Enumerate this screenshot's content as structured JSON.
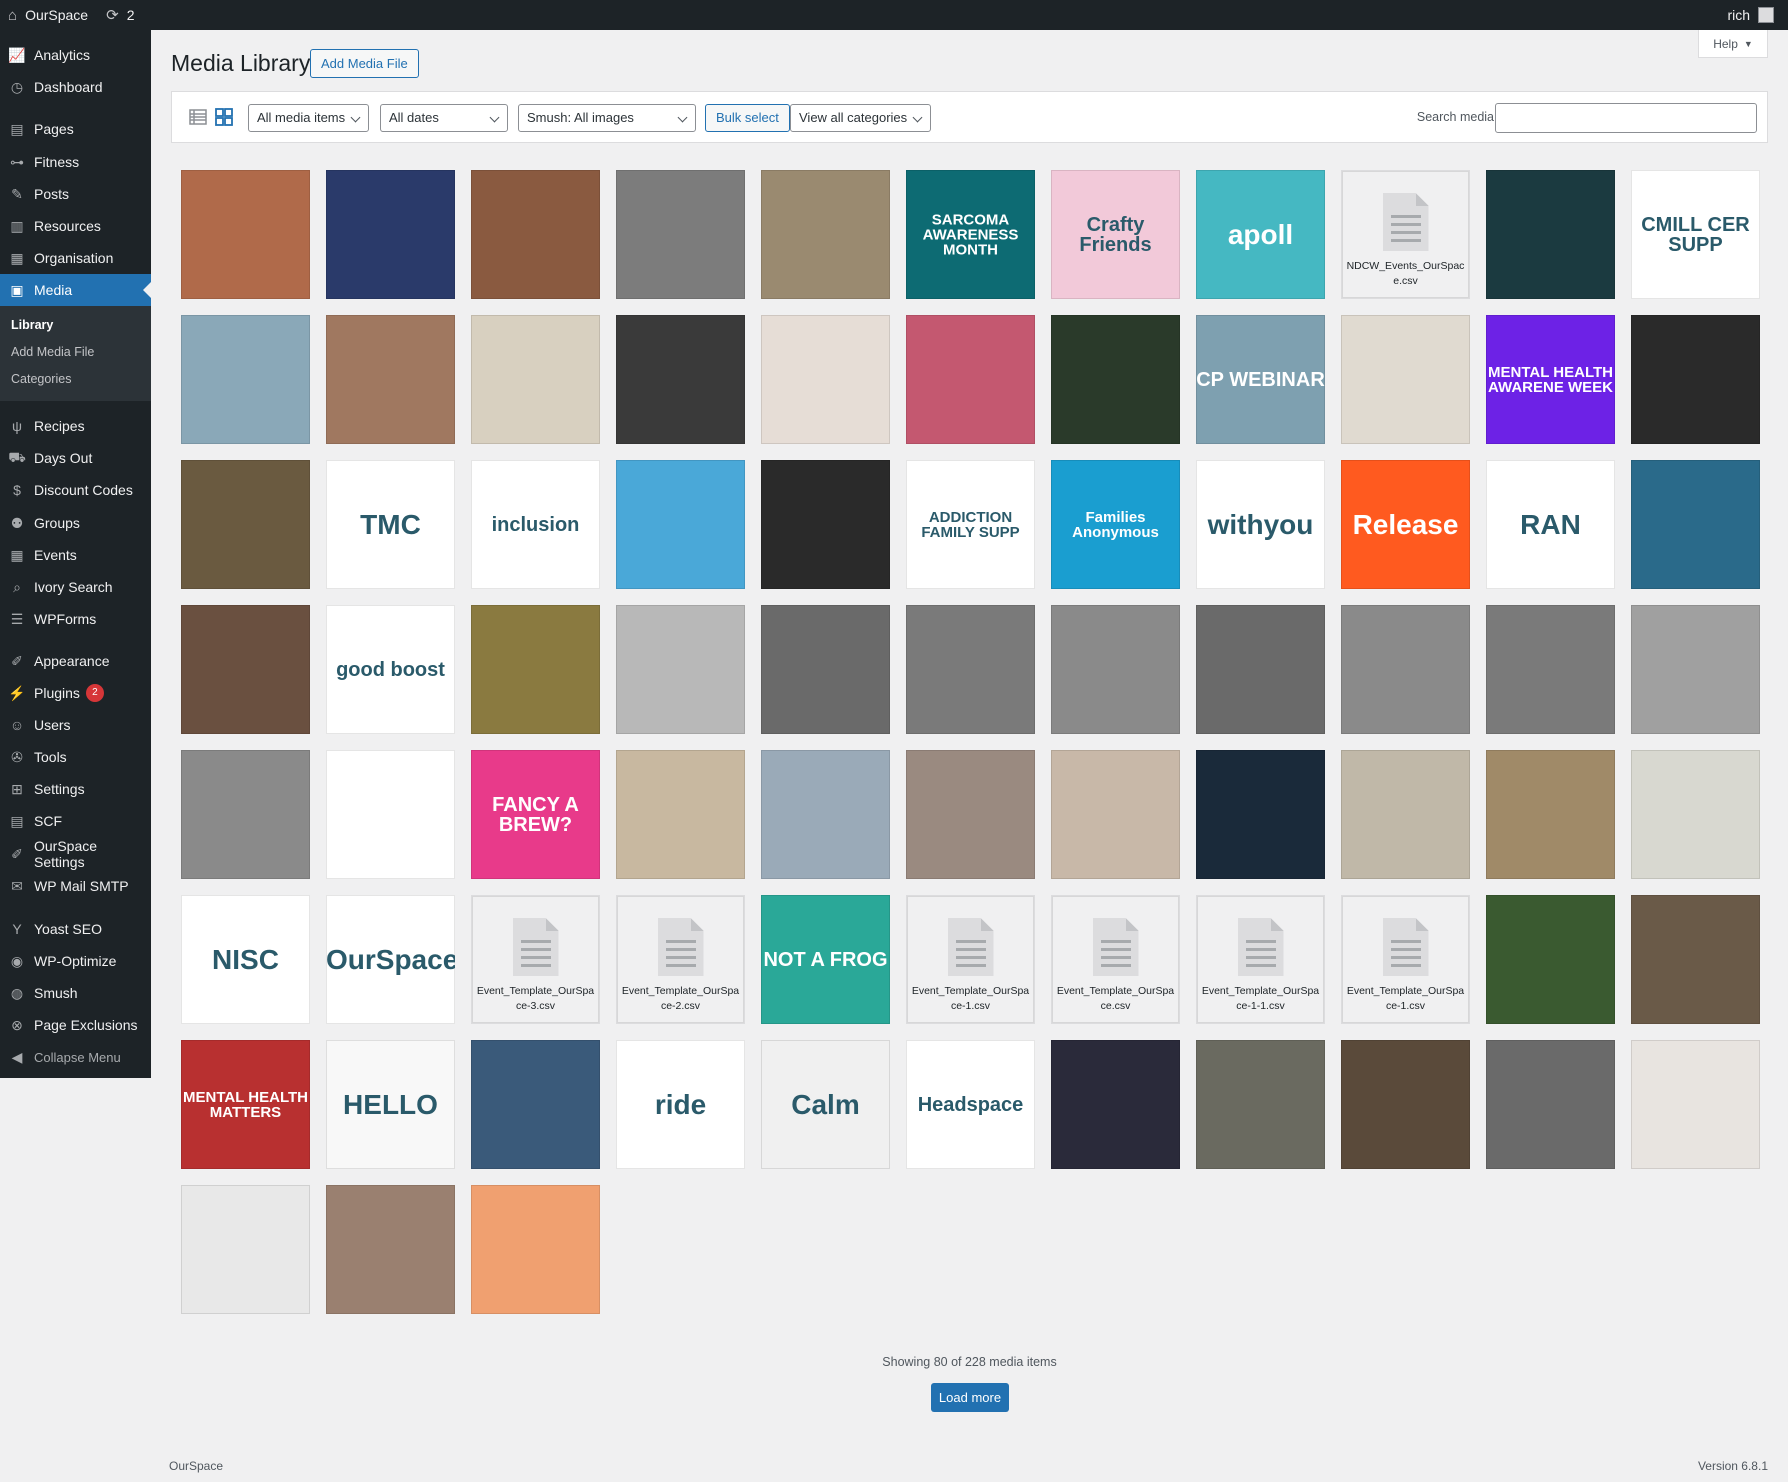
{
  "admin_bar": {
    "site_name": "OurSpace",
    "updates_count": "2",
    "user": "rich"
  },
  "sidebar": {
    "items": [
      {
        "label": "Analytics",
        "icon": "chart-line-icon",
        "glyph": "📈"
      },
      {
        "label": "Dashboard",
        "icon": "dashboard-icon",
        "glyph": "◷"
      },
      {
        "label": "Pages",
        "icon": "pages-icon",
        "glyph": "▤"
      },
      {
        "label": "Fitness",
        "icon": "dumbbell-icon",
        "glyph": "⊶"
      },
      {
        "label": "Posts",
        "icon": "pin-icon",
        "glyph": "✎"
      },
      {
        "label": "Resources",
        "icon": "book-icon",
        "glyph": "▥"
      },
      {
        "label": "Organisation",
        "icon": "building-icon",
        "glyph": "▦"
      },
      {
        "label": "Media",
        "icon": "media-icon",
        "glyph": "▣"
      },
      {
        "label": "Recipes",
        "icon": "utensils-icon",
        "glyph": "ψ"
      },
      {
        "label": "Days Out",
        "icon": "car-icon",
        "glyph": "⛟"
      },
      {
        "label": "Discount Codes",
        "icon": "dollar-icon",
        "glyph": "$"
      },
      {
        "label": "Groups",
        "icon": "groups-icon",
        "glyph": "⚉"
      },
      {
        "label": "Events",
        "icon": "calendar-icon",
        "glyph": "▦"
      },
      {
        "label": "Ivory Search",
        "icon": "search-icon",
        "glyph": "⌕"
      },
      {
        "label": "WPForms",
        "icon": "forms-icon",
        "glyph": "☰"
      },
      {
        "label": "Appearance",
        "icon": "paintbrush-icon",
        "glyph": "✐"
      },
      {
        "label": "Plugins",
        "icon": "plug-icon",
        "glyph": "⚡",
        "badge": "2"
      },
      {
        "label": "Users",
        "icon": "user-icon",
        "glyph": "☺"
      },
      {
        "label": "Tools",
        "icon": "wrench-icon",
        "glyph": "✇"
      },
      {
        "label": "Settings",
        "icon": "settings-icon",
        "glyph": "⊞"
      },
      {
        "label": "SCF",
        "icon": "scf-icon",
        "glyph": "▤"
      },
      {
        "label": "OurSpace Settings",
        "icon": "brush-icon",
        "glyph": "✐"
      },
      {
        "label": "WP Mail SMTP",
        "icon": "mail-icon",
        "glyph": "✉"
      },
      {
        "label": "Yoast SEO",
        "icon": "yoast-icon",
        "glyph": "Y"
      },
      {
        "label": "WP-Optimize",
        "icon": "optimize-icon",
        "glyph": "◉"
      },
      {
        "label": "Smush",
        "icon": "smush-icon",
        "glyph": "◍"
      },
      {
        "label": "Page Exclusions",
        "icon": "exclusion-icon",
        "glyph": "⊗"
      }
    ],
    "submenu": [
      "Library",
      "Add Media File",
      "Categories"
    ],
    "collapse": "Collapse Menu"
  },
  "help": "Help",
  "page": {
    "title": "Media Library",
    "add_button": "Add Media File"
  },
  "toolbar": {
    "filter_type": "All media items",
    "filter_dates": "All dates",
    "filter_smush": "Smush: All images",
    "bulk_select": "Bulk select",
    "filter_categories": "View all categories",
    "search_label": "Search media"
  },
  "tiles": [
    [
      "#b06a4a",
      "#2a3a6a",
      "#8a5a40",
      "#7c7c7c",
      "#9a8a70",
      "#0d6b73",
      "#f2c9d9",
      "#45b8c2",
      "doc",
      "#1b3a40",
      "#ffffff"
    ],
    [
      "#8aa8b8",
      "#a07860",
      "#d8d0c0",
      "#3a3a3a",
      "#e6ddd6",
      "#c45870",
      "#2a3a2a",
      "#7ea0b0",
      "#e0dad0",
      "#6d22e6",
      "#2a2a2a"
    ],
    [
      "#6a5a40",
      "#ffffff",
      "#ffffff",
      "#4aa8d8",
      "#2a2a2a",
      "#ffffff",
      "#1a9ed0",
      "#ffffff",
      "#ff5a1f",
      "#ffffff",
      "#2a6a8a"
    ],
    [
      "#6a5040",
      "#ffffff",
      "#8a7a40",
      "#b8b8b8",
      "#6a6a6a",
      "#7a7a7a",
      "#8a8a8a",
      "#6a6a6a",
      "#8a8a8a",
      "#7a7a7a",
      "#a0a0a0"
    ],
    [
      "#8a8a8a",
      "#ffffff",
      "#e83a8a",
      "#c8b8a0",
      "#9aaab8",
      "#9a8a80",
      "#c8b8a8",
      "#1a2a3a",
      "#c0b8a8",
      "#a08a68",
      "#d8d8d0"
    ],
    [
      "#ffffff",
      "#ffffff",
      "doc",
      "doc",
      "#2aa898",
      "doc",
      "doc",
      "doc",
      "doc",
      "#3a5a30",
      "#6a5a48"
    ],
    [
      "#b83030",
      "#f8f8f8",
      "#3a5a7a",
      "#ffffff",
      "#f0f0f0",
      "#ffffff",
      "#2a2a3a",
      "#6a6a60",
      "#5a4a3a",
      "#6a6a6a",
      "#e8e4e0"
    ],
    [
      "#e8e8e8",
      "#9a8070",
      "#f0a070"
    ]
  ],
  "tile_text": {
    "0-5": "SARCOMA AWARENESS MONTH",
    "0-6": "Crafty Friends",
    "0-7": "apoll",
    "0-10": "CMILL CER SUPP",
    "1-7": "CP WEBINAR",
    "1-9": "MENTAL HEALTH AWARENE WEEK",
    "2-1": "TMC",
    "2-2": "inclusion",
    "2-5": "ADDICTION FAMILY SUPP",
    "2-6": "Families Anonymous",
    "2-7": "withyou",
    "2-8": "Release",
    "2-9": "RAN",
    "3-1": "good boost",
    "4-2": "FANCY A BREW?",
    "5-0": "NISC",
    "5-1": "OurSpace",
    "5-4": "NOT A FROG",
    "6-0": "MENTAL HEALTH MATTERS",
    "6-1": "HELLO",
    "6-3": "ride",
    "6-4": "Calm",
    "6-5": "Headspace"
  },
  "docs": {
    "0-8": "NDCW_Events_OurSpace.csv",
    "5-2": "Event_Template_OurSpace-3.csv",
    "5-3": "Event_Template_OurSpace-2.csv",
    "5-5": "Event_Template_OurSpace-1.csv",
    "5-6": "Event_Template_OurSpace.csv",
    "5-7": "Event_Template_OurSpace-1-1.csv",
    "5-8": "Event_Template_OurSpace-1.csv"
  },
  "status": "Showing 80 of 228 media items",
  "load_more": "Load more",
  "footer": {
    "left": "OurSpace",
    "right": "Version 6.8.1"
  }
}
